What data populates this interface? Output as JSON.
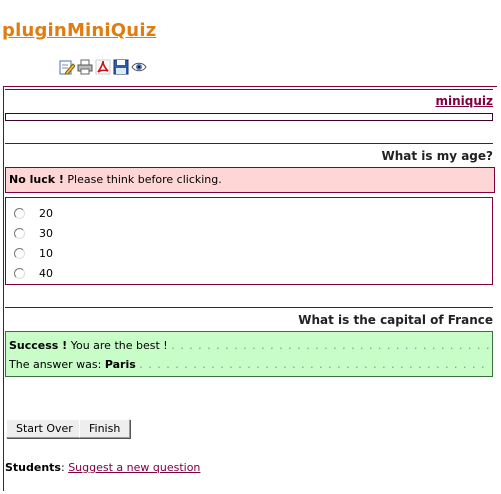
{
  "page": {
    "title": "pluginMiniQuiz"
  },
  "toolbar": {
    "icons": [
      "edit-icon",
      "print-icon",
      "pdf-icon",
      "save-icon",
      "view-icon"
    ]
  },
  "module": {
    "title": "miniquiz"
  },
  "questions": [
    {
      "text": "What is my age?",
      "feedback": {
        "status": "No luck !",
        "message": "Please think before clicking."
      },
      "options": [
        "20",
        "30",
        "10",
        "40"
      ]
    },
    {
      "text": "What is the capital of France",
      "feedback": {
        "status": "Success !",
        "message": "You are the best !",
        "answer_label": "The answer was:",
        "answer": "Paris"
      }
    }
  ],
  "buttons": {
    "start_over": "Start Over",
    "finish": "Finish"
  },
  "footer": {
    "label": "Students",
    "link": "Suggest a new question"
  },
  "colors": {
    "title": "#e07c10",
    "frame": "#800040",
    "failure_bg": "#ffd6d6",
    "success_bg": "#c8fdc8"
  }
}
